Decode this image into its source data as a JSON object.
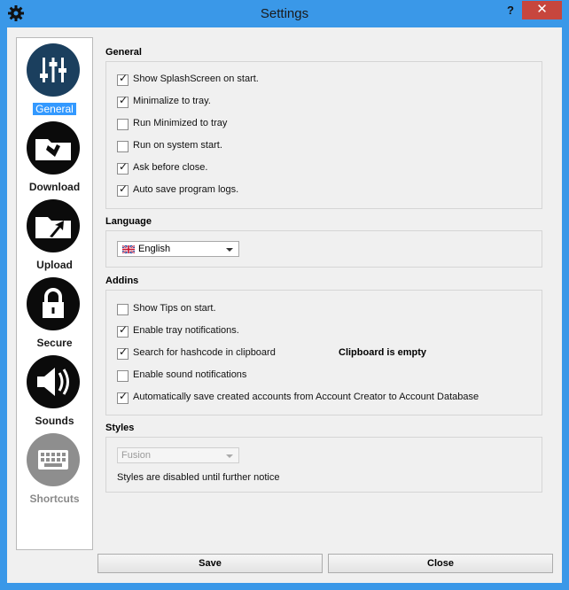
{
  "window": {
    "title": "Settings",
    "help_label": "?",
    "close_label": "✕"
  },
  "sidebar": {
    "items": [
      {
        "label": "General",
        "icon": "equalizer-icon",
        "state": "active"
      },
      {
        "label": "Download",
        "icon": "folder-download-icon",
        "state": "normal"
      },
      {
        "label": "Upload",
        "icon": "folder-upload-icon",
        "state": "normal"
      },
      {
        "label": "Secure",
        "icon": "padlock-icon",
        "state": "normal"
      },
      {
        "label": "Sounds",
        "icon": "speaker-icon",
        "state": "normal"
      },
      {
        "label": "Shortcuts",
        "icon": "keyboard-icon",
        "state": "disabled"
      }
    ]
  },
  "general": {
    "title": "General",
    "options": [
      {
        "label": "Show SplashScreen on start.",
        "checked": true
      },
      {
        "label": "Minimalize to tray.",
        "checked": true
      },
      {
        "label": "Run Minimized to tray",
        "checked": false
      },
      {
        "label": "Run on system start.",
        "checked": false
      },
      {
        "label": "Ask before close.",
        "checked": true
      },
      {
        "label": "Auto save program logs.",
        "checked": true
      }
    ]
  },
  "language": {
    "title": "Language",
    "selected": "English"
  },
  "addins": {
    "title": "Addins",
    "options": [
      {
        "label": "Show Tips on start.",
        "checked": false
      },
      {
        "label": "Enable tray notifications.",
        "checked": true
      },
      {
        "label": "Search for hashcode in clipboard",
        "checked": true
      },
      {
        "label": "Enable sound notifications",
        "checked": false
      },
      {
        "label": "Automatically save created accounts from Account Creator to Account Database",
        "checked": true
      }
    ],
    "clipboard_status": "Clipboard is empty"
  },
  "styles": {
    "title": "Styles",
    "selected": "Fusion",
    "note": "Styles are disabled until further notice"
  },
  "buttons": {
    "save": "Save",
    "close": "Close"
  },
  "colors": {
    "titlebar": "#3a98e8",
    "close_button": "#c7463d",
    "active_nav": "#3399ff"
  }
}
